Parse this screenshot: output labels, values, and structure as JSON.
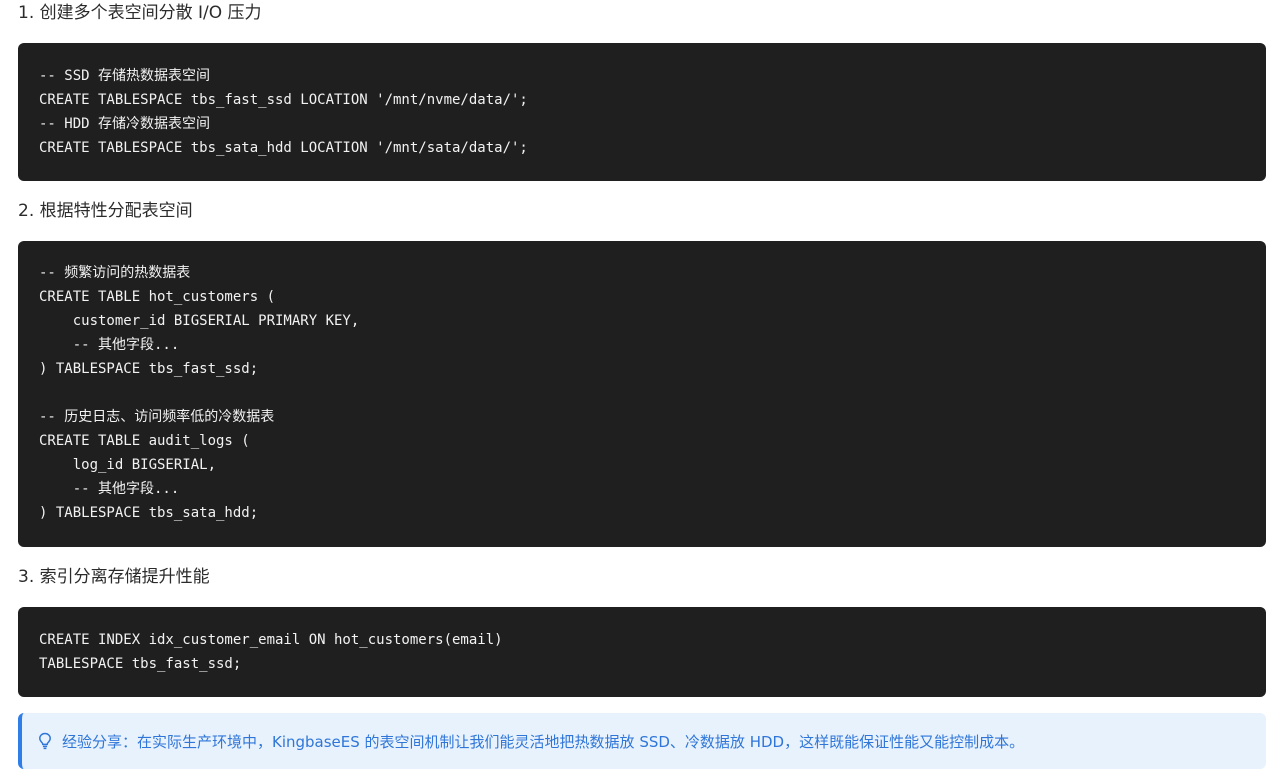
{
  "sections": [
    {
      "heading": "1. 创建多个表空间分散 I/O 压力",
      "code": "-- SSD 存储热数据表空间\nCREATE TABLESPACE tbs_fast_ssd LOCATION '/mnt/nvme/data/';\n-- HDD 存储冷数据表空间\nCREATE TABLESPACE tbs_sata_hdd LOCATION '/mnt/sata/data/';"
    },
    {
      "heading": "2. 根据特性分配表空间",
      "code": "-- 频繁访问的热数据表\nCREATE TABLE hot_customers (\n    customer_id BIGSERIAL PRIMARY KEY,\n    -- 其他字段...\n) TABLESPACE tbs_fast_ssd;\n\n-- 历史日志、访问频率低的冷数据表\nCREATE TABLE audit_logs (\n    log_id BIGSERIAL,\n    -- 其他字段...\n) TABLESPACE tbs_sata_hdd;"
    },
    {
      "heading": "3. 索引分离存储提升性能",
      "code": "CREATE INDEX idx_customer_email ON hot_customers(email)\nTABLESPACE tbs_fast_ssd;"
    }
  ],
  "tip": {
    "icon": "lightbulb-icon",
    "text": "经验分享：在实际生产环境中，KingbaseES 的表空间机制让我们能灵活地把热数据放 SSD、冷数据放 HDD，这样既能保证性能又能控制成本。"
  },
  "colors": {
    "code_background": "#1f1f1f",
    "code_text": "#f2f2f2",
    "tip_background": "#e8f2fd",
    "tip_accent": "#2f7ee8"
  }
}
